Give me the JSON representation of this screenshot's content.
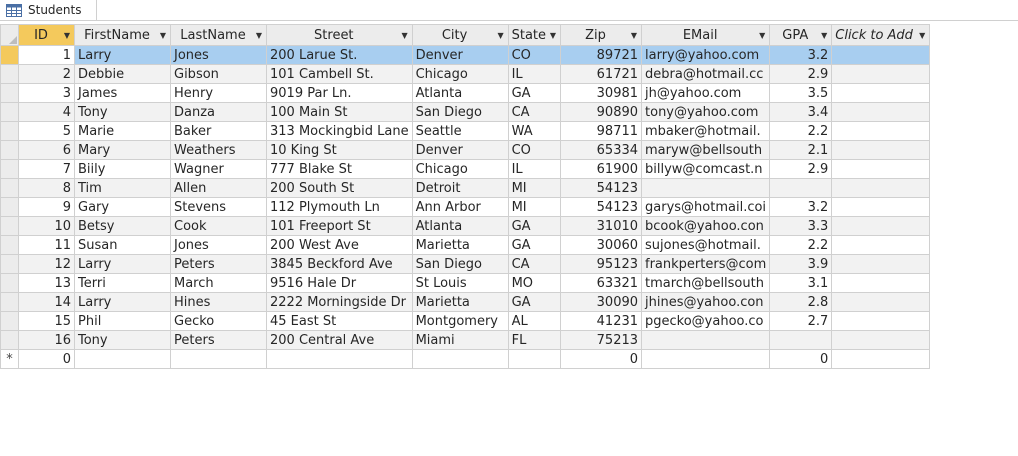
{
  "tab": {
    "label": "Students"
  },
  "columns": [
    {
      "label": "ID"
    },
    {
      "label": "FirstName"
    },
    {
      "label": "LastName"
    },
    {
      "label": "Street"
    },
    {
      "label": "City"
    },
    {
      "label": "State"
    },
    {
      "label": "Zip"
    },
    {
      "label": "EMail"
    },
    {
      "label": "GPA"
    },
    {
      "label": "Click to Add"
    }
  ],
  "rows": [
    {
      "id": "1",
      "first": "Larry",
      "last": "Jones",
      "street": "200 Larue St.",
      "city": "Denver",
      "state": "CO",
      "zip": "89721",
      "email": "larry@yahoo.com",
      "gpa": "3.2"
    },
    {
      "id": "2",
      "first": "Debbie",
      "last": "Gibson",
      "street": "101 Cambell St.",
      "city": "Chicago",
      "state": "IL",
      "zip": "61721",
      "email": "debra@hotmail.cc",
      "gpa": "2.9"
    },
    {
      "id": "3",
      "first": "James",
      "last": "Henry",
      "street": "9019 Par Ln.",
      "city": "Atlanta",
      "state": "GA",
      "zip": "30981",
      "email": "jh@yahoo.com",
      "gpa": "3.5"
    },
    {
      "id": "4",
      "first": "Tony",
      "last": "Danza",
      "street": "100 Main St",
      "city": "San Diego",
      "state": "CA",
      "zip": "90890",
      "email": "tony@yahoo.com",
      "gpa": "3.4"
    },
    {
      "id": "5",
      "first": "Marie",
      "last": "Baker",
      "street": "313 Mockingbid Lane",
      "city": "Seattle",
      "state": "WA",
      "zip": "98711",
      "email": "mbaker@hotmail.",
      "gpa": "2.2"
    },
    {
      "id": "6",
      "first": "Mary",
      "last": "Weathers",
      "street": "10 King St",
      "city": "Denver",
      "state": "CO",
      "zip": "65334",
      "email": "maryw@bellsouth",
      "gpa": "2.1"
    },
    {
      "id": "7",
      "first": "Biily",
      "last": "Wagner",
      "street": "777 Blake St",
      "city": "Chicago",
      "state": "IL",
      "zip": "61900",
      "email": "billyw@comcast.n",
      "gpa": "2.9"
    },
    {
      "id": "8",
      "first": "Tim",
      "last": "Allen",
      "street": "200 South St",
      "city": "Detroit",
      "state": "MI",
      "zip": "54123",
      "email": "",
      "gpa": ""
    },
    {
      "id": "9",
      "first": "Gary",
      "last": "Stevens",
      "street": "112 Plymouth Ln",
      "city": "Ann Arbor",
      "state": "MI",
      "zip": "54123",
      "email": "garys@hotmail.coi",
      "gpa": "3.2"
    },
    {
      "id": "10",
      "first": "Betsy",
      "last": "Cook",
      "street": "101 Freeport St",
      "city": "Atlanta",
      "state": "GA",
      "zip": "31010",
      "email": "bcook@yahoo.con",
      "gpa": "3.3"
    },
    {
      "id": "11",
      "first": "Susan",
      "last": "Jones",
      "street": "200 West Ave",
      "city": "Marietta",
      "state": "GA",
      "zip": "30060",
      "email": "sujones@hotmail.",
      "gpa": "2.2"
    },
    {
      "id": "12",
      "first": "Larry",
      "last": "Peters",
      "street": "3845 Beckford Ave",
      "city": "San Diego",
      "state": "CA",
      "zip": "95123",
      "email": "frankperters@com",
      "gpa": "3.9"
    },
    {
      "id": "13",
      "first": "Terri",
      "last": "March",
      "street": "9516 Hale Dr",
      "city": "St Louis",
      "state": "MO",
      "zip": "63321",
      "email": "tmarch@bellsouth",
      "gpa": "3.1"
    },
    {
      "id": "14",
      "first": "Larry",
      "last": "Hines",
      "street": "2222 Morningside Dr",
      "city": "Marietta",
      "state": "GA",
      "zip": "30090",
      "email": "jhines@yahoo.con",
      "gpa": "2.8"
    },
    {
      "id": "15",
      "first": "Phil",
      "last": "Gecko",
      "street": "45 East St",
      "city": "Montgomery",
      "state": "AL",
      "zip": "41231",
      "email": "pgecko@yahoo.co",
      "gpa": "2.7"
    },
    {
      "id": "16",
      "first": "Tony",
      "last": "Peters",
      "street": "200 Central Ave",
      "city": "Miami",
      "state": "FL",
      "zip": "75213",
      "email": "",
      "gpa": ""
    }
  ],
  "new_row": {
    "marker": "*",
    "id": "0",
    "zip": "0",
    "gpa": "0"
  }
}
